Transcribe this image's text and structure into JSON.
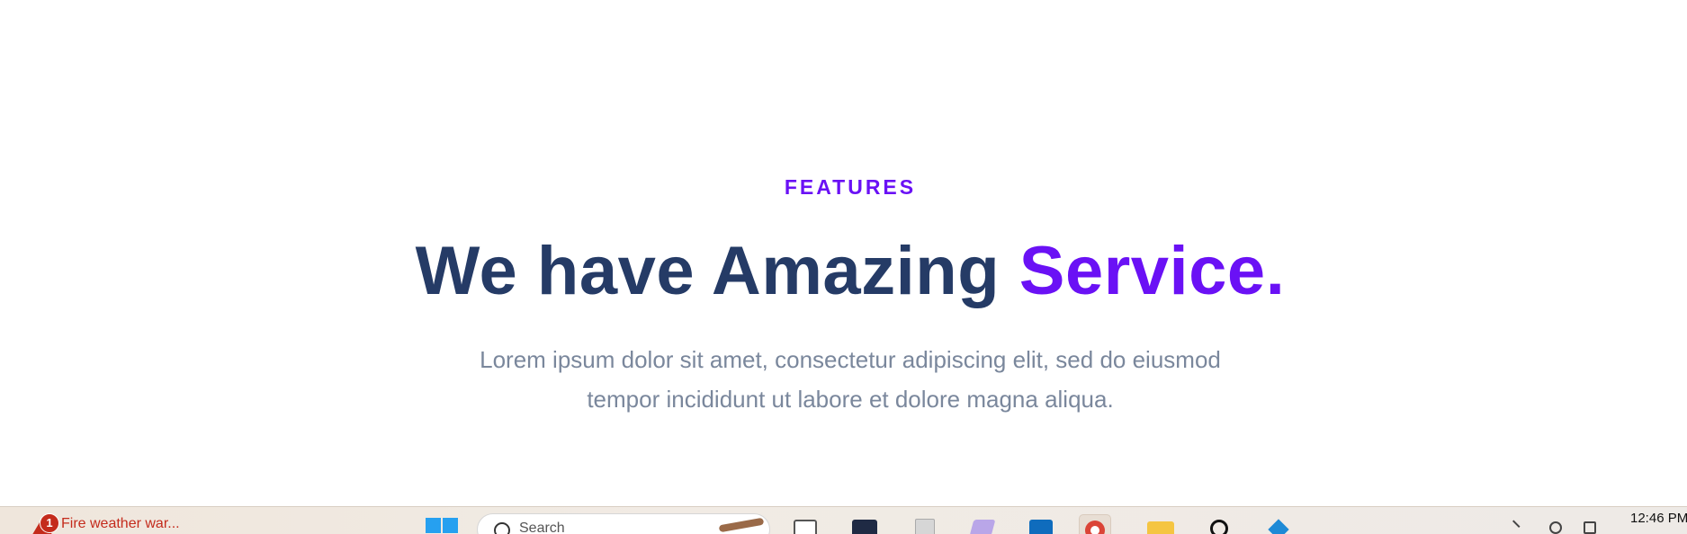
{
  "colors": {
    "accent": "#6a11f5",
    "heading": "#253b66",
    "body_text": "#7a879c",
    "weather_alert": "#c42b1c"
  },
  "hero": {
    "eyebrow": "FEATURES",
    "headline_main": "We have Amazing ",
    "headline_accent": "Service",
    "headline_dot": ".",
    "subtext": "Lorem ipsum dolor sit amet, consectetur adipiscing elit, sed do eiusmod tempor incididunt ut labore et dolore magna aliqua."
  },
  "taskbar": {
    "weather_badge": "1",
    "weather_text": "Fire weather war...",
    "search_placeholder": "Search",
    "clock_time": "12:46 PM",
    "icons": [
      "windows-start-icon",
      "search-icon",
      "task-view-icon",
      "terminal-icon",
      "file-icon",
      "visual-studio-icon",
      "outlook-icon",
      "chrome-icon",
      "file-explorer-icon",
      "chatgpt-icon",
      "vscode-icon"
    ]
  }
}
